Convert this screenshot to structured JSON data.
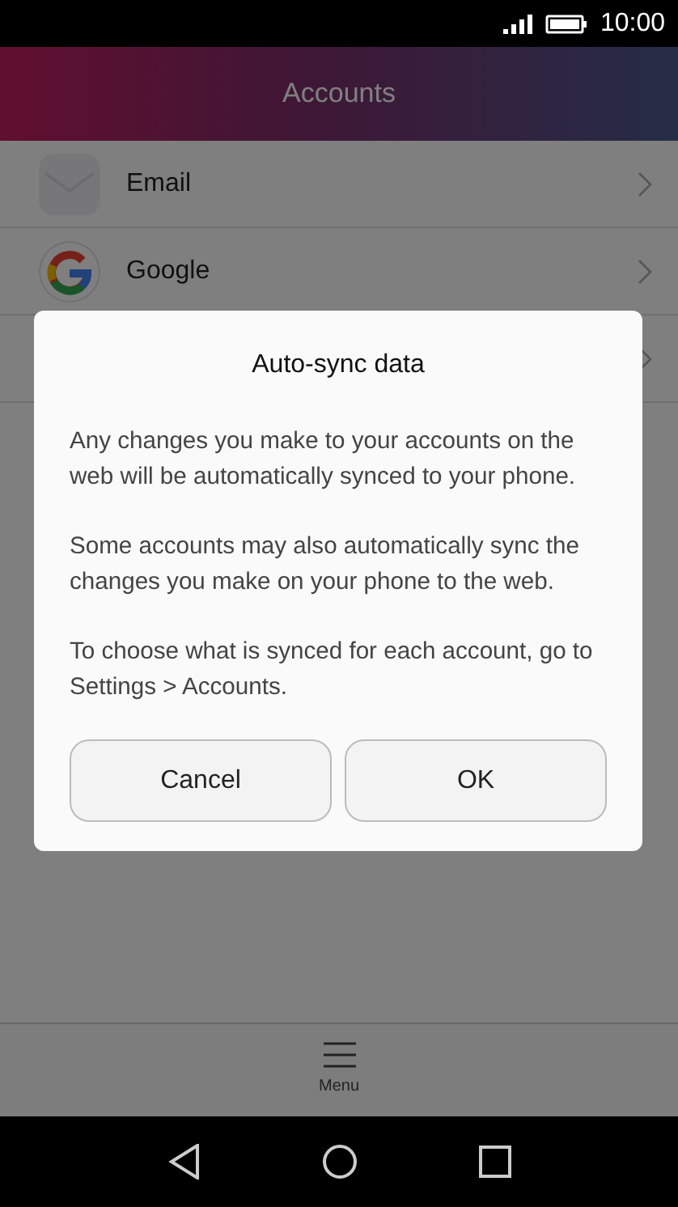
{
  "status_bar": {
    "time": "10:00"
  },
  "header": {
    "title": "Accounts"
  },
  "accounts": [
    {
      "kind": "email",
      "label": "Email"
    },
    {
      "kind": "google",
      "label": "Google"
    },
    {
      "kind": "hidden"
    }
  ],
  "dialog": {
    "title": "Auto-sync data",
    "paragraphs": [
      "Any changes you make to your accounts on the web will be automatically synced to your phone.",
      "Some accounts may also automatically sync the changes you make on your phone to the web.",
      "To choose what is synced for each account, go to Settings > Accounts."
    ],
    "buttons": [
      "Cancel",
      "OK"
    ]
  },
  "bottom_bar": {
    "label": "Menu"
  }
}
